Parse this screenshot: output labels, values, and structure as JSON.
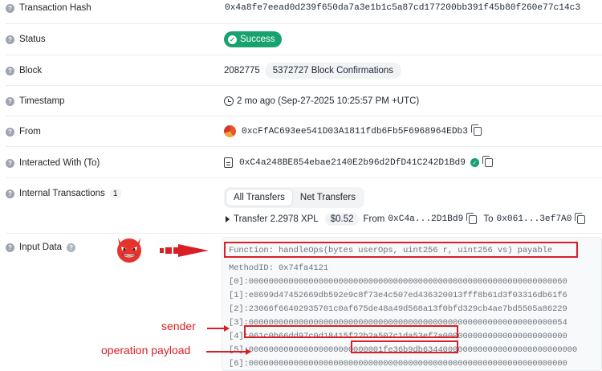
{
  "labels": {
    "tx_hash": "Transaction Hash",
    "status": "Status",
    "block": "Block",
    "timestamp": "Timestamp",
    "from": "From",
    "interacted": "Interacted With (To)",
    "internal": "Internal Transactions",
    "internal_count": "1",
    "input": "Input Data"
  },
  "values": {
    "tx_hash": "0x4a8fe7eead0d239f650da7a3e1b1c5a87cd177200bb391f45b80f260e77c14c3",
    "status": "Success",
    "block_number": "2082775",
    "confirmations": "5372727 Block Confirmations",
    "timestamp": "2 mo ago (Sep-27-2025 10:25:57 PM +UTC)",
    "from_address": "0xcFfAC693ee541D03A1811fdb6Fb5F6968964EDb3",
    "to_address": "0xC4a248BE854ebae2140E2b96d2DfD41C242D1Bd9"
  },
  "internal_tabs": [
    "All Transfers",
    "Net Transfers"
  ],
  "transfer": {
    "label": "Transfer 2.2978 XPL",
    "usd": "$0.52",
    "from_label": "From",
    "from_short": "0xC4a...2D1Bd9",
    "to_label": "To",
    "to_short": "0x061...3ef7A0"
  },
  "input_data": {
    "function_line": "Function: handleOps(bytes userOps, uint256 r, uint256 vs) payable",
    "lines": [
      "MethodID: 0x74fa4121",
      "[0]:0000000000000000000000000000000000000000000000000000000000000060",
      "[1]:e8699d47452669db592e9c8f73e4c507ed436320013fff8b61d3f03316db61f6",
      "[2]:23066f66402935701c0af675de48a49d568a13f0bfd329cb4ae7bd5505a86229",
      "[3]:0000000000000000000000000000000000000000000000000000000000000054",
      "[4]:061c0b66dd97c0d18415f22b2a507c1da53ef7a0000000000000000000000000",
      "[5]:000000000000000000000000001fe36b9db6344000000000000000000000000000",
      "[6]:0000000000000000000000000000000000000000000000000000000000000000"
    ]
  },
  "annotations": {
    "sender": "sender",
    "payload": "operation payload"
  },
  "colors": {
    "accent_red": "#d91f26",
    "success_green": "#17a26f"
  },
  "icons": [
    "help-icon",
    "check-circle-icon",
    "clock-icon",
    "copy-icon",
    "contract-icon",
    "verified-icon",
    "devil-emoji-icon",
    "red-arrow-icon"
  ]
}
